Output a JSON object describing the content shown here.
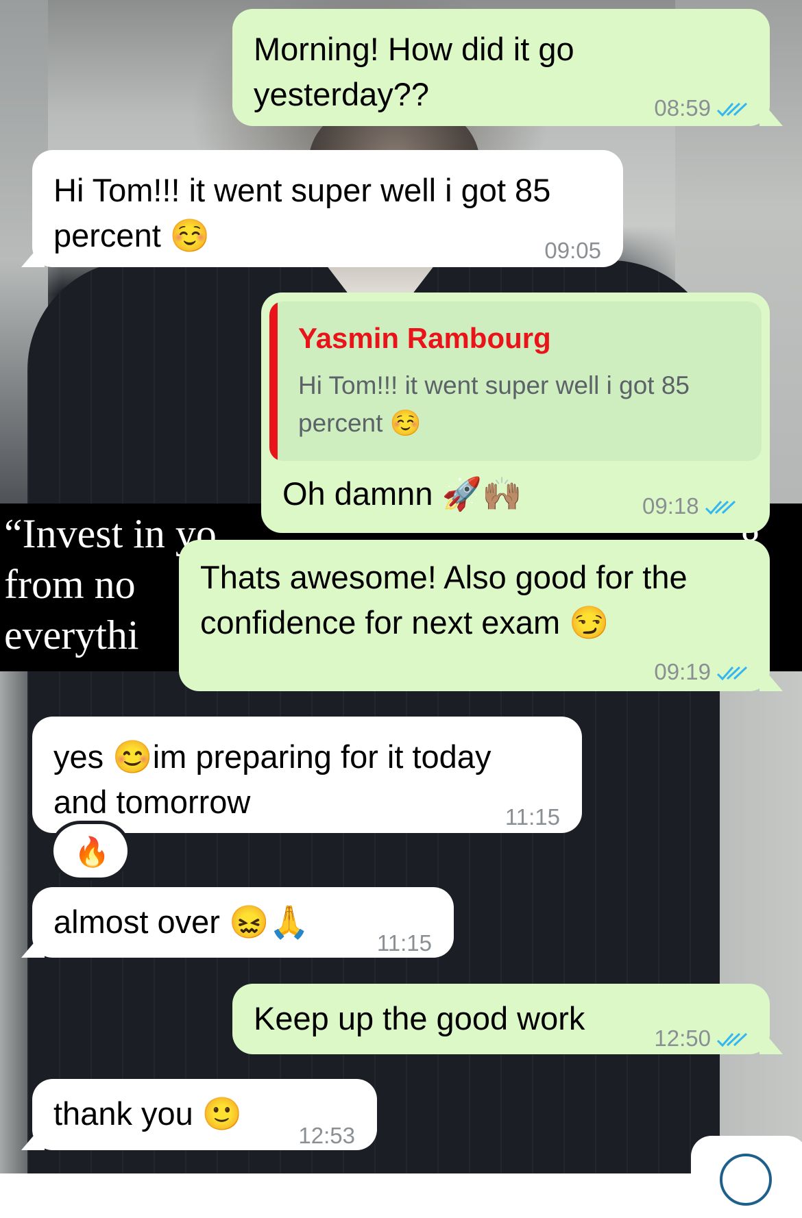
{
  "background": {
    "quote_lines": [
      "“Invest in yo",
      "from no",
      "everythi"
    ],
    "quote_right": "g"
  },
  "messages": [
    {
      "id": "m1",
      "direction": "outgoing",
      "text_lines": [
        "Morning! How did it go",
        "yesterday??"
      ],
      "time": "08:59",
      "read": true
    },
    {
      "id": "m2",
      "direction": "incoming",
      "text_lines": [
        "Hi Tom!!! it went super well i got 85",
        "percent ☺️"
      ],
      "time": "09:05"
    },
    {
      "id": "m3",
      "direction": "outgoing",
      "reply_to": {
        "name": "Yasmin Rambourg",
        "text_lines": [
          "Hi Tom!!! it went super well i got 85",
          "percent ☺️"
        ]
      },
      "text": "Oh damnn 🚀🙌🏽",
      "time": "09:18",
      "read": true
    },
    {
      "id": "m4",
      "direction": "outgoing",
      "text_lines": [
        "Thats awesome! Also good for the",
        "confidence for next exam 😏"
      ],
      "time": "09:19",
      "read": true
    },
    {
      "id": "m5",
      "direction": "incoming",
      "text_lines": [
        "yes 😊im preparing for it today",
        "and tomorrow"
      ],
      "time": "11:15",
      "reaction": "🔥"
    },
    {
      "id": "m6",
      "direction": "incoming",
      "text": "almost over 😖🙏",
      "time": "11:15"
    },
    {
      "id": "m7",
      "direction": "outgoing",
      "text": "Keep up the good work",
      "time": "12:50",
      "read": true
    },
    {
      "id": "m8",
      "direction": "incoming",
      "text": "thank you 🙂",
      "time": "12:53"
    }
  ],
  "colors": {
    "outgoing": "#dcf8c6",
    "incoming": "#ffffff",
    "read_ticks": "#34b7f1",
    "reply_name": "#e8141a"
  }
}
